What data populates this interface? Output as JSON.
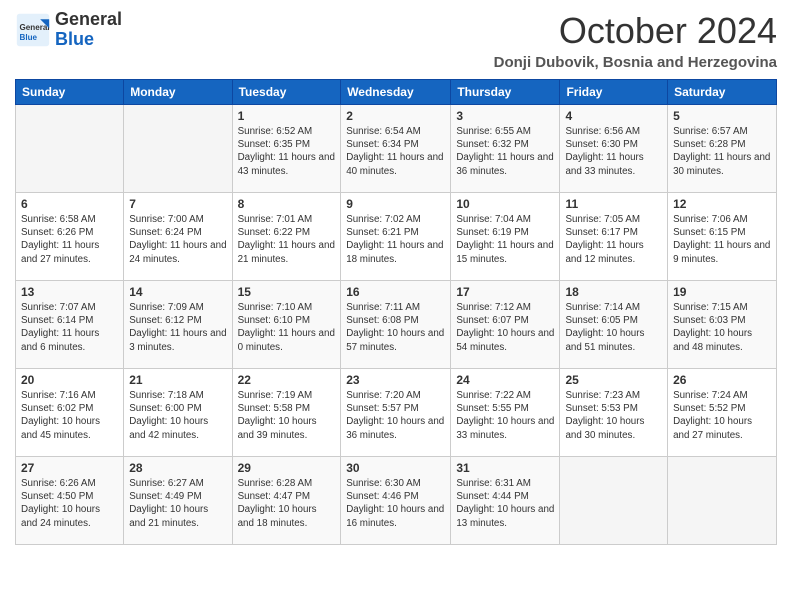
{
  "header": {
    "logo_general": "General",
    "logo_blue": "Blue",
    "month_title": "October 2024",
    "location": "Donji Dubovik, Bosnia and Herzegovina"
  },
  "days_of_week": [
    "Sunday",
    "Monday",
    "Tuesday",
    "Wednesday",
    "Thursday",
    "Friday",
    "Saturday"
  ],
  "weeks": [
    [
      {
        "num": "",
        "info": ""
      },
      {
        "num": "",
        "info": ""
      },
      {
        "num": "1",
        "info": "Sunrise: 6:52 AM\nSunset: 6:35 PM\nDaylight: 11 hours and 43 minutes."
      },
      {
        "num": "2",
        "info": "Sunrise: 6:54 AM\nSunset: 6:34 PM\nDaylight: 11 hours and 40 minutes."
      },
      {
        "num": "3",
        "info": "Sunrise: 6:55 AM\nSunset: 6:32 PM\nDaylight: 11 hours and 36 minutes."
      },
      {
        "num": "4",
        "info": "Sunrise: 6:56 AM\nSunset: 6:30 PM\nDaylight: 11 hours and 33 minutes."
      },
      {
        "num": "5",
        "info": "Sunrise: 6:57 AM\nSunset: 6:28 PM\nDaylight: 11 hours and 30 minutes."
      }
    ],
    [
      {
        "num": "6",
        "info": "Sunrise: 6:58 AM\nSunset: 6:26 PM\nDaylight: 11 hours and 27 minutes."
      },
      {
        "num": "7",
        "info": "Sunrise: 7:00 AM\nSunset: 6:24 PM\nDaylight: 11 hours and 24 minutes."
      },
      {
        "num": "8",
        "info": "Sunrise: 7:01 AM\nSunset: 6:22 PM\nDaylight: 11 hours and 21 minutes."
      },
      {
        "num": "9",
        "info": "Sunrise: 7:02 AM\nSunset: 6:21 PM\nDaylight: 11 hours and 18 minutes."
      },
      {
        "num": "10",
        "info": "Sunrise: 7:04 AM\nSunset: 6:19 PM\nDaylight: 11 hours and 15 minutes."
      },
      {
        "num": "11",
        "info": "Sunrise: 7:05 AM\nSunset: 6:17 PM\nDaylight: 11 hours and 12 minutes."
      },
      {
        "num": "12",
        "info": "Sunrise: 7:06 AM\nSunset: 6:15 PM\nDaylight: 11 hours and 9 minutes."
      }
    ],
    [
      {
        "num": "13",
        "info": "Sunrise: 7:07 AM\nSunset: 6:14 PM\nDaylight: 11 hours and 6 minutes."
      },
      {
        "num": "14",
        "info": "Sunrise: 7:09 AM\nSunset: 6:12 PM\nDaylight: 11 hours and 3 minutes."
      },
      {
        "num": "15",
        "info": "Sunrise: 7:10 AM\nSunset: 6:10 PM\nDaylight: 11 hours and 0 minutes."
      },
      {
        "num": "16",
        "info": "Sunrise: 7:11 AM\nSunset: 6:08 PM\nDaylight: 10 hours and 57 minutes."
      },
      {
        "num": "17",
        "info": "Sunrise: 7:12 AM\nSunset: 6:07 PM\nDaylight: 10 hours and 54 minutes."
      },
      {
        "num": "18",
        "info": "Sunrise: 7:14 AM\nSunset: 6:05 PM\nDaylight: 10 hours and 51 minutes."
      },
      {
        "num": "19",
        "info": "Sunrise: 7:15 AM\nSunset: 6:03 PM\nDaylight: 10 hours and 48 minutes."
      }
    ],
    [
      {
        "num": "20",
        "info": "Sunrise: 7:16 AM\nSunset: 6:02 PM\nDaylight: 10 hours and 45 minutes."
      },
      {
        "num": "21",
        "info": "Sunrise: 7:18 AM\nSunset: 6:00 PM\nDaylight: 10 hours and 42 minutes."
      },
      {
        "num": "22",
        "info": "Sunrise: 7:19 AM\nSunset: 5:58 PM\nDaylight: 10 hours and 39 minutes."
      },
      {
        "num": "23",
        "info": "Sunrise: 7:20 AM\nSunset: 5:57 PM\nDaylight: 10 hours and 36 minutes."
      },
      {
        "num": "24",
        "info": "Sunrise: 7:22 AM\nSunset: 5:55 PM\nDaylight: 10 hours and 33 minutes."
      },
      {
        "num": "25",
        "info": "Sunrise: 7:23 AM\nSunset: 5:53 PM\nDaylight: 10 hours and 30 minutes."
      },
      {
        "num": "26",
        "info": "Sunrise: 7:24 AM\nSunset: 5:52 PM\nDaylight: 10 hours and 27 minutes."
      }
    ],
    [
      {
        "num": "27",
        "info": "Sunrise: 6:26 AM\nSunset: 4:50 PM\nDaylight: 10 hours and 24 minutes."
      },
      {
        "num": "28",
        "info": "Sunrise: 6:27 AM\nSunset: 4:49 PM\nDaylight: 10 hours and 21 minutes."
      },
      {
        "num": "29",
        "info": "Sunrise: 6:28 AM\nSunset: 4:47 PM\nDaylight: 10 hours and 18 minutes."
      },
      {
        "num": "30",
        "info": "Sunrise: 6:30 AM\nSunset: 4:46 PM\nDaylight: 10 hours and 16 minutes."
      },
      {
        "num": "31",
        "info": "Sunrise: 6:31 AM\nSunset: 4:44 PM\nDaylight: 10 hours and 13 minutes."
      },
      {
        "num": "",
        "info": ""
      },
      {
        "num": "",
        "info": ""
      }
    ]
  ]
}
